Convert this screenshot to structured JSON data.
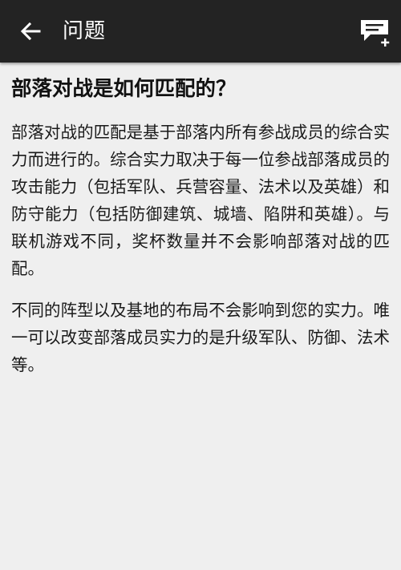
{
  "header": {
    "title": "问题",
    "back_icon": "arrow-left-icon",
    "action_icon": "new-question-icon"
  },
  "article": {
    "title": "部落对战是如何匹配的？",
    "paragraphs": [
      "部落对战的匹配是基于部落内所有参战成员的综合实力而进行的。综合实力取决于每一位参战部落成员的攻击能力（包括军队、兵营容量、法术以及英雄）和防守能力（包括防御建筑、城墙、陷阱和英雄）。与联机游戏不同，奖杯数量并不会影响部落对战的匹配。",
      "不同的阵型以及基地的布局不会影响到您的实力。唯一可以改变部落成员实力的是升级军队、防御、法术等。"
    ]
  },
  "colors": {
    "header_bg": "#232323",
    "page_bg": "#efefef",
    "text": "#1a1a1a"
  }
}
